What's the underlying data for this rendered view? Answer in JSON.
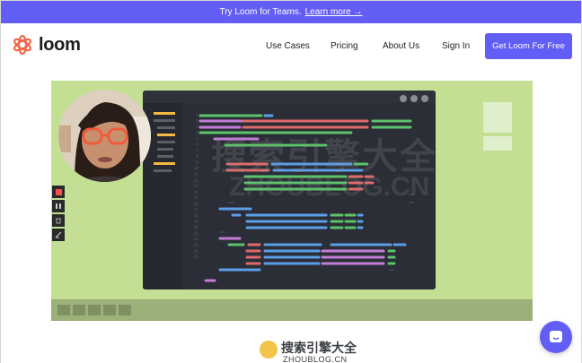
{
  "banner": {
    "text": "Try Loom for Teams.",
    "link": "Learn more →"
  },
  "brand": {
    "name": "loom",
    "color": "#625df5",
    "logo_color": "#f06a4b"
  },
  "nav": {
    "links": [
      "Use Cases",
      "Pricing",
      "About Us",
      "Sign In"
    ],
    "cta": "Get Loom For Free"
  },
  "icons": {
    "record": "stop-record-icon",
    "pause": "pause-icon",
    "delete": "trash-icon",
    "draw": "pen-icon",
    "chat": "chat-icon"
  },
  "watermark": {
    "big": "搜索引擎大全",
    "big_sub": "ZHOUBLOG.CN",
    "small": "搜索引擎大全",
    "small_sub": "ZHOUBLOG.CN"
  },
  "editor": {
    "line_numbers": [
      "1",
      "2",
      "3",
      "4",
      "5",
      "6",
      "7",
      "8",
      "9",
      "10",
      "11",
      "12",
      "13",
      "14",
      "15",
      "16",
      "17",
      "18",
      "19",
      "20",
      "21",
      "22",
      "23",
      "24",
      "25"
    ]
  }
}
